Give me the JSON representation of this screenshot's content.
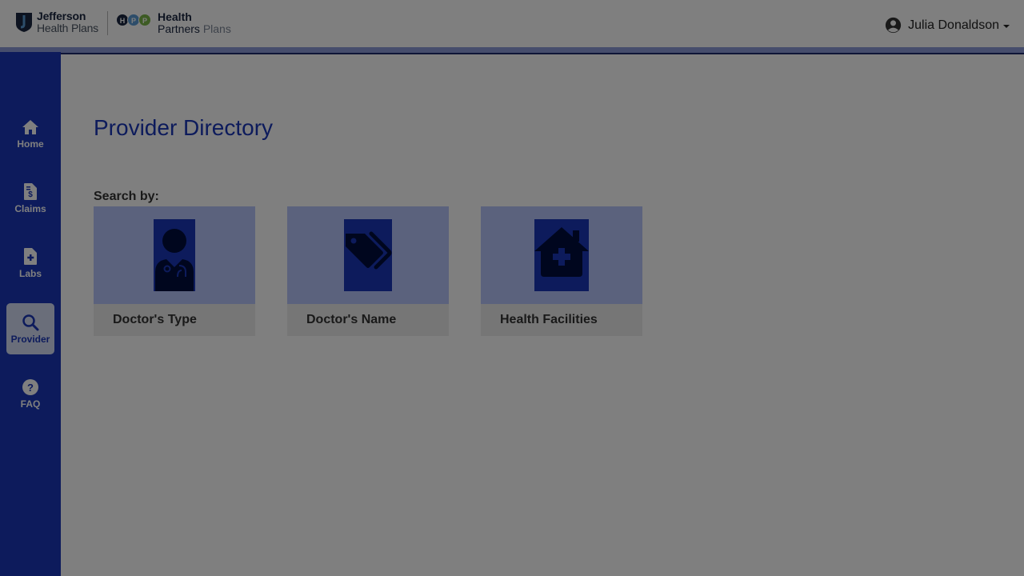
{
  "header": {
    "logo_jefferson": {
      "line1": "Jefferson",
      "line2": "Health Plans"
    },
    "logo_hpp": {
      "dots": [
        "H",
        "P",
        "P"
      ],
      "line1": "Health",
      "line2": "Partners",
      "line2_suffix": "Plans"
    },
    "user": {
      "name": "Julia Donaldson",
      "icon": "user-circle-icon"
    }
  },
  "sidebar": {
    "items": [
      {
        "label": "Home",
        "icon": "home-icon",
        "active": false
      },
      {
        "label": "Claims",
        "icon": "claims-document-icon",
        "active": false
      },
      {
        "label": "Labs",
        "icon": "labs-document-icon",
        "active": false
      },
      {
        "label": "Provider",
        "icon": "search-icon",
        "active": true
      },
      {
        "label": "FAQ",
        "icon": "question-circle-icon",
        "active": false
      }
    ]
  },
  "main": {
    "title": "Provider Directory",
    "search_by_label": "Search by:",
    "cards": [
      {
        "label": "Doctor's Type",
        "icon": "doctor-icon"
      },
      {
        "label": "Doctor's Name",
        "icon": "tags-icon"
      },
      {
        "label": "Health Facilities",
        "icon": "clinic-house-medical-icon"
      }
    ]
  },
  "colors": {
    "brand_blue": "#1a37b8",
    "card_image_bg": "#b7c5fb",
    "header_bar": "#8d9bd8",
    "overlay": "rgba(0,0,0,0.5)"
  }
}
